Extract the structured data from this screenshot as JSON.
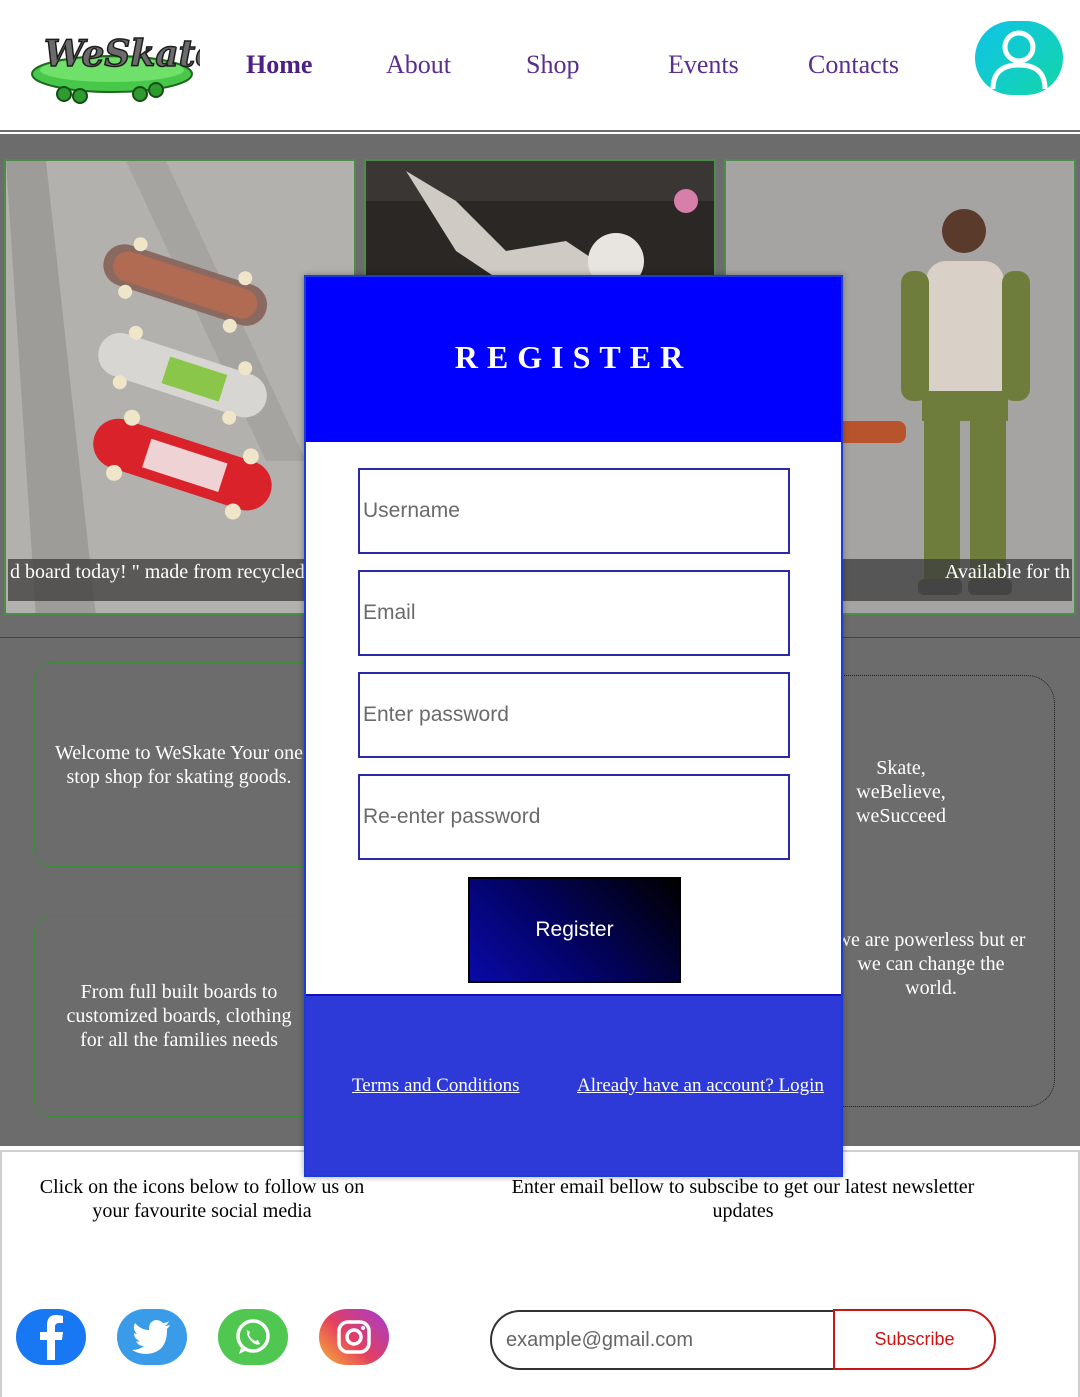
{
  "header": {
    "logo_text": "WeSkate",
    "nav": [
      {
        "label": "Home",
        "active": true
      },
      {
        "label": "About"
      },
      {
        "label": "Shop"
      },
      {
        "label": "Events"
      },
      {
        "label": "Contacts"
      }
    ],
    "avatar_icon": "user-icon"
  },
  "gallery": {
    "captions": [
      "d board today! \" made from recycled",
      "Available for th"
    ]
  },
  "cards": {
    "left_top": "Welcome to WeSkate Your one stop shop for skating goods.",
    "left_bottom": "From full built boards to customized boards, clothing for all the families needs",
    "right_top": "Skate, weBelieve, weSucceed",
    "right_bottom": "we are powerless but er we can change the world."
  },
  "modal": {
    "title": "REGISTER",
    "fields": {
      "username": "Username",
      "email": "Email",
      "password": "Enter password",
      "repassword": "Re-enter password"
    },
    "register_label": "Register",
    "terms_label": "Terms and Conditions",
    "login_label": "Already have an account? Login"
  },
  "footer": {
    "social_text": "Click on the icons below to follow us on your favourite social media",
    "newsletter_text": "Enter email bellow to subscibe to get our latest newsletter updates",
    "email_placeholder": "example@gmail.com",
    "subscribe_label": "Subscribe",
    "social_icons": [
      "facebook-icon",
      "twitter-icon",
      "whatsapp-icon",
      "instagram-icon"
    ]
  },
  "colors": {
    "nav_text": "#5a2d91",
    "modal_header": "#0000ff",
    "modal_footer": "#2d3ad8",
    "page_gray": "#6c6c6c",
    "subscribe_red": "#d41010"
  }
}
